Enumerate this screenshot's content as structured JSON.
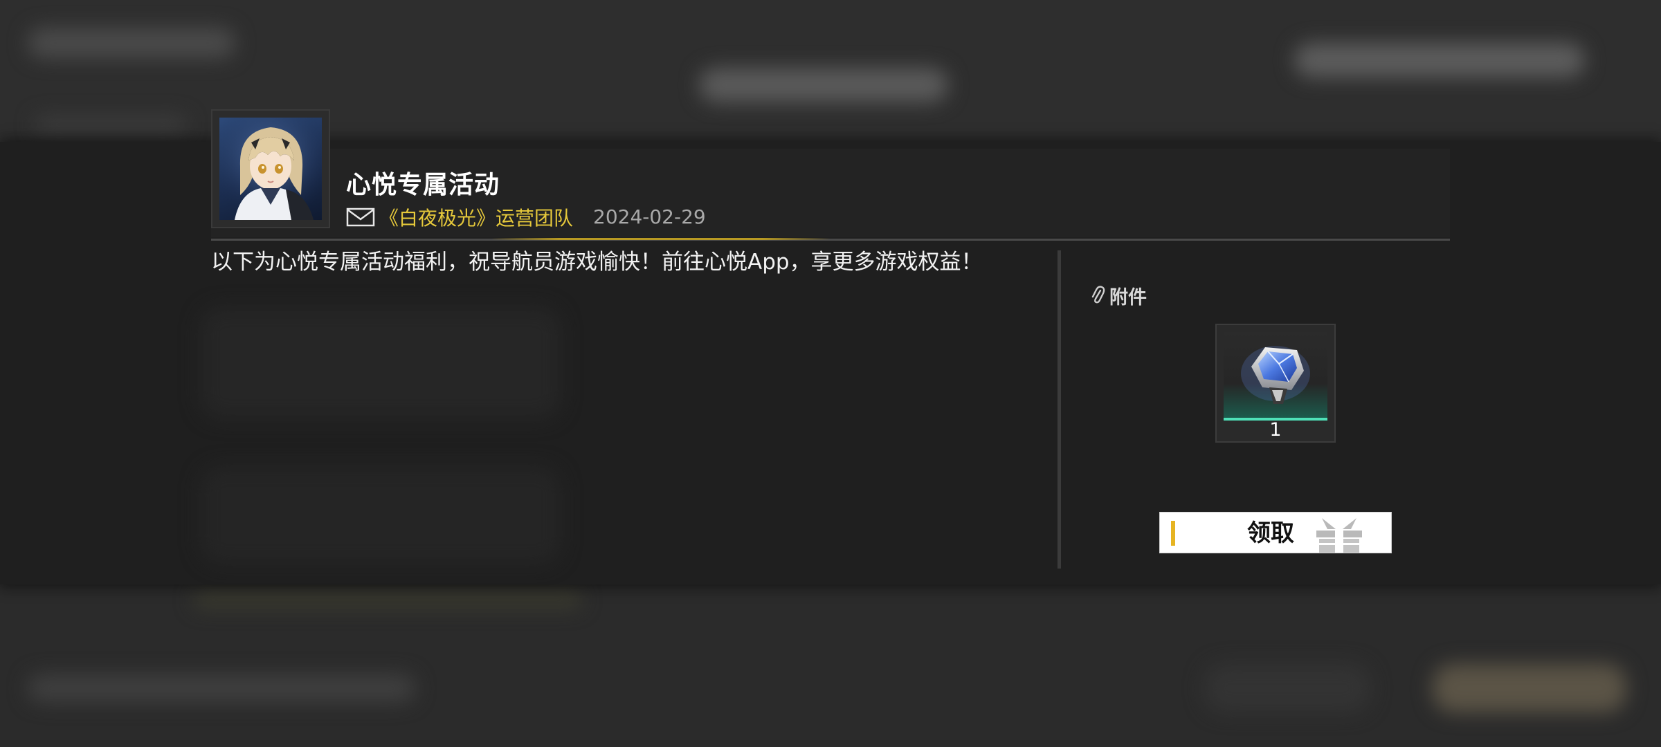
{
  "mail": {
    "title": "心悦专属活动",
    "sender": "《白夜极光》运营团队",
    "date": "2024-02-29",
    "body": "以下为心悦专属活动福利，祝导航员游戏愉快！前往心悦App，享更多游戏权益！"
  },
  "attachments": {
    "label": "附件",
    "items": [
      {
        "icon": "crystal-item-icon",
        "count": "1"
      }
    ]
  },
  "actions": {
    "claim_label": "领取"
  },
  "colors": {
    "accent_yellow": "#e6c93b",
    "panel_bg": "#1f1f1f",
    "rarity_green": "#4fe0b8"
  }
}
